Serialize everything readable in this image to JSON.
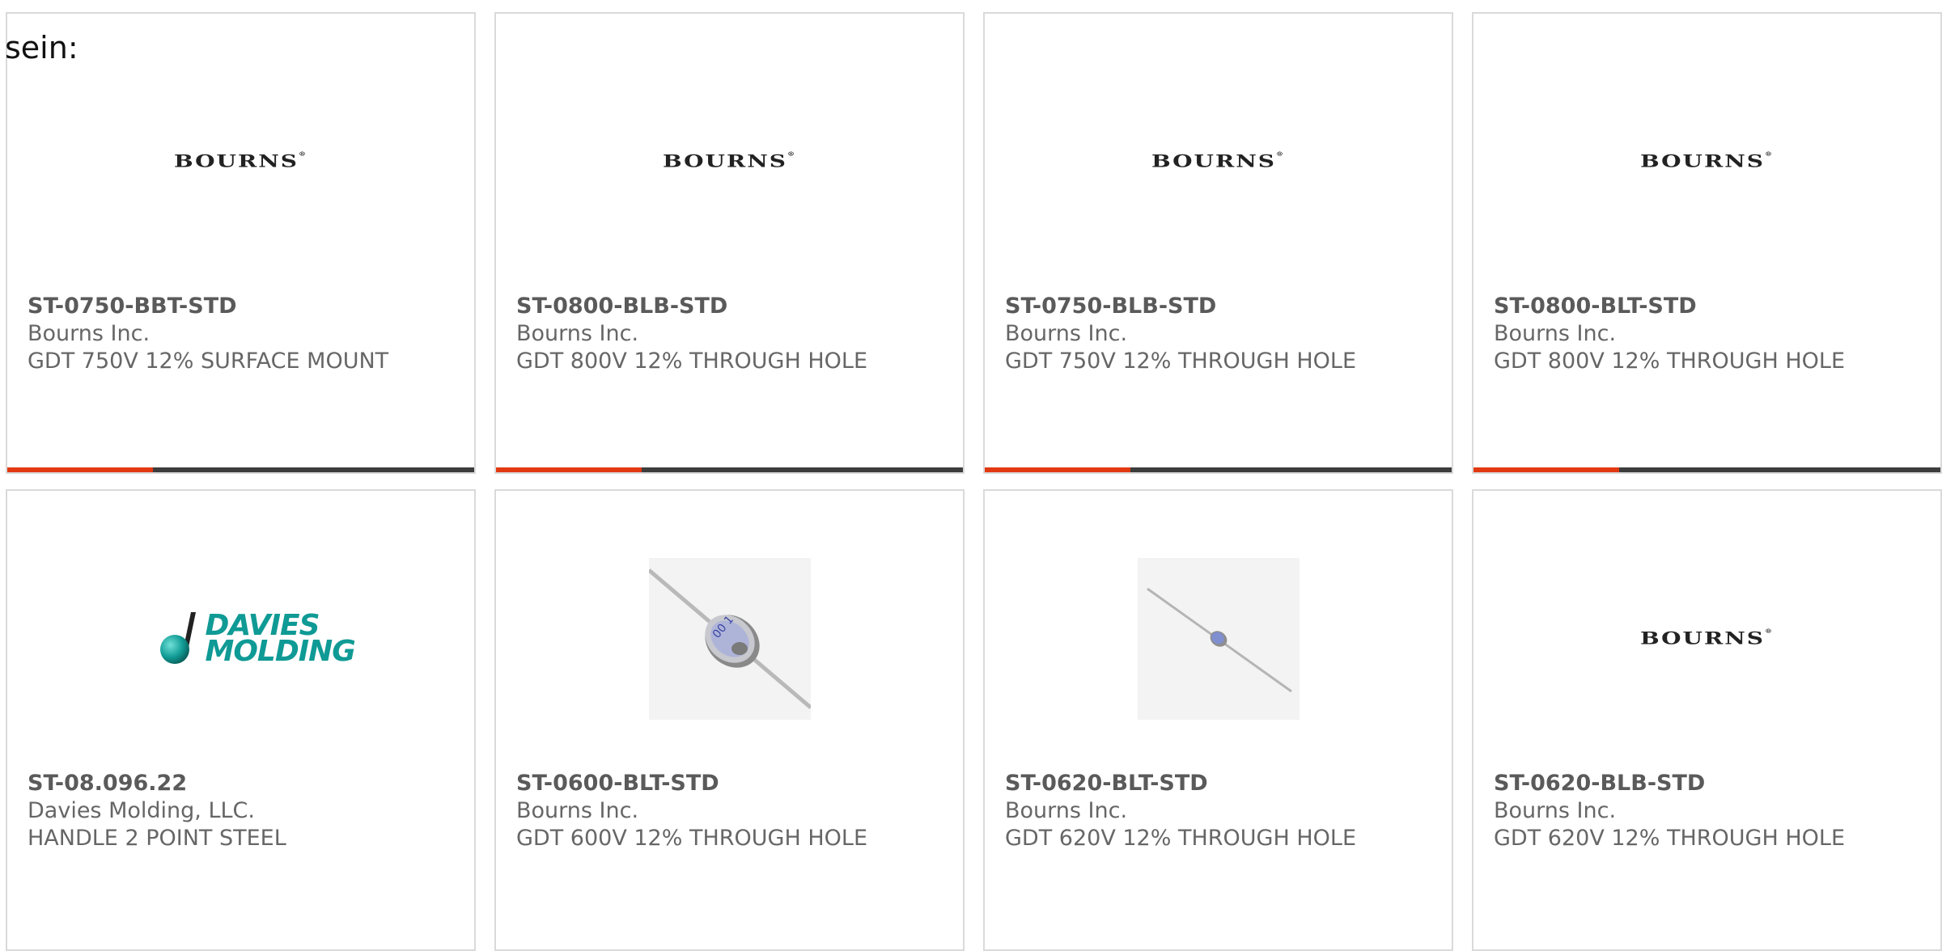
{
  "intro_text": "sein:",
  "colors": {
    "accent": "#e13a12",
    "bar": "#3d3d3d",
    "border": "#dadada",
    "davies_teal": "#0f9a95"
  },
  "products": [
    {
      "part": "ST-0750-BBT-STD",
      "maker": "Bourns Inc.",
      "desc": "GDT 750V 12% SURFACE MOUNT",
      "image": "bourns-logo",
      "logo_text": "BOURNS"
    },
    {
      "part": "ST-0800-BLB-STD",
      "maker": "Bourns Inc.",
      "desc": "GDT 800V 12% THROUGH HOLE",
      "image": "bourns-logo",
      "logo_text": "BOURNS"
    },
    {
      "part": "ST-0750-BLB-STD",
      "maker": "Bourns Inc.",
      "desc": "GDT 750V 12% THROUGH HOLE",
      "image": "bourns-logo",
      "logo_text": "BOURNS"
    },
    {
      "part": "ST-0800-BLT-STD",
      "maker": "Bourns Inc.",
      "desc": "GDT 800V 12% THROUGH HOLE",
      "image": "bourns-logo",
      "logo_text": "BOURNS"
    },
    {
      "part": "ST-08.096.22",
      "maker": "Davies Molding, LLC.",
      "desc": "HANDLE 2 POINT STEEL",
      "image": "davies-molding-logo",
      "logo_text": "DAVIES MOLDING"
    },
    {
      "part": "ST-0600-BLT-STD",
      "maker": "Bourns Inc.",
      "desc": "GDT 600V 12% THROUGH HOLE",
      "image": "gdt-component-photo-large"
    },
    {
      "part": "ST-0620-BLT-STD",
      "maker": "Bourns Inc.",
      "desc": "GDT 620V 12% THROUGH HOLE",
      "image": "gdt-component-photo-small"
    },
    {
      "part": "ST-0620-BLB-STD",
      "maker": "Bourns Inc.",
      "desc": "GDT 620V 12% THROUGH HOLE",
      "image": "bourns-logo",
      "logo_text": "BOURNS"
    }
  ]
}
